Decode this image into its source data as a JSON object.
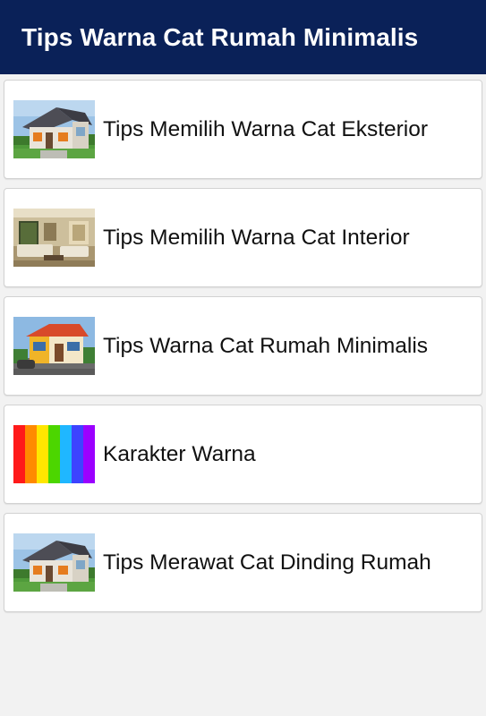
{
  "app_bar": {
    "title": "Tips Warna Cat Rumah Minimalis",
    "background": "#0a2158"
  },
  "menu": {
    "items": [
      {
        "label": "Tips Memilih Warna Cat Eksterior",
        "thumbnail": "house-exterior-photo"
      },
      {
        "label": "Tips Memilih Warna Cat Interior",
        "thumbnail": "living-room-photo"
      },
      {
        "label": "Tips Warna Cat Rumah Minimalis",
        "thumbnail": "colorful-house-photo"
      },
      {
        "label": "Karakter Warna",
        "thumbnail": "rainbow-stripes"
      },
      {
        "label": "Tips Merawat Cat Dinding Rumah",
        "thumbnail": "house-exterior-photo"
      }
    ]
  }
}
